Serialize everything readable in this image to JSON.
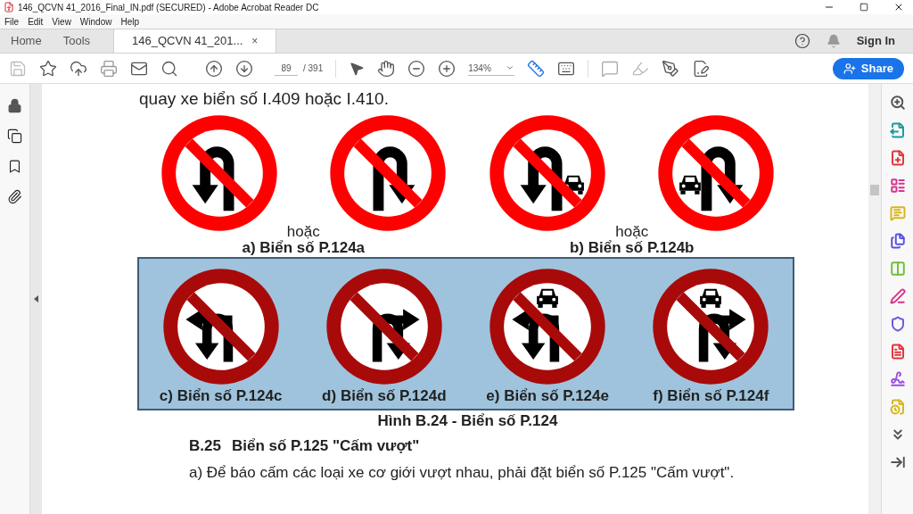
{
  "window": {
    "title": "146_QCVN 41_2016_Final_IN.pdf (SECURED) - Adobe Acrobat Reader DC"
  },
  "menu": [
    "File",
    "Edit",
    "View",
    "Window",
    "Help"
  ],
  "tabs": [
    {
      "label": "Home",
      "selected": false
    },
    {
      "label": "Tools",
      "selected": false
    },
    {
      "label": "146_QCVN 41_201...",
      "selected": true,
      "close": "×"
    }
  ],
  "sign_in": "Sign In",
  "toolbar": {
    "page": "89",
    "page_total": "/ 391",
    "zoom": "134%",
    "share": "Share"
  },
  "right_tools": [
    {
      "color": "#555555"
    },
    {
      "color": "#1a9a9a"
    },
    {
      "color": "#e0353a"
    },
    {
      "color": "#d6348c"
    },
    {
      "color": "#d9b51a"
    },
    {
      "color": "#5a4fe0"
    },
    {
      "color": "#6fbf3a"
    },
    {
      "color": "#d6348c"
    },
    {
      "color": "#6a5ae0"
    },
    {
      "color": "#e0353a"
    },
    {
      "color": "#9a4fe0"
    },
    {
      "color": "#d9b51a"
    },
    {
      "color": "#555555"
    },
    {
      "color": "#555555"
    }
  ],
  "document": {
    "intro": "quay xe biển số I.409 hoặc I.410.",
    "rows": [
      {
        "highlighted": false,
        "groups": [
          {
            "caption": "a) Biển số P.124a",
            "joiner": "hoặc",
            "signs": [
              {
                "kind": "uturn",
                "mirrored": false,
                "car": false
              },
              {
                "kind": "uturn",
                "mirrored": true,
                "car": false
              }
            ]
          },
          {
            "caption": "b) Biển số P.124b",
            "joiner": "hoặc",
            "signs": [
              {
                "kind": "uturn",
                "mirrored": false,
                "car": true
              },
              {
                "kind": "uturn",
                "mirrored": true,
                "car": true
              }
            ]
          }
        ]
      },
      {
        "highlighted": true,
        "groups": [
          {
            "caption": "c) Biển số P.124c",
            "signs": [
              {
                "kind": "turn-uturn",
                "mirrored": false,
                "car": false
              }
            ]
          },
          {
            "caption": "d) Biển số P.124d",
            "signs": [
              {
                "kind": "turn-uturn",
                "mirrored": true,
                "car": false
              }
            ]
          },
          {
            "caption": "e) Biển số P.124e",
            "signs": [
              {
                "kind": "turn-uturn",
                "mirrored": false,
                "car": true
              }
            ]
          },
          {
            "caption": "f) Biển số P.124f",
            "signs": [
              {
                "kind": "turn-uturn",
                "mirrored": true,
                "car": true
              }
            ]
          }
        ]
      }
    ],
    "figure_caption": "Hình B.24 - Biển số P.124",
    "heading_number": "B.25",
    "heading": "Biển số P.125 \"Cấm vượt\"",
    "paragraph": "a) Để báo cấm các loại xe cơ giới vượt nhau, phải đặt biển số P.125 \"Cấm vượt\"."
  }
}
